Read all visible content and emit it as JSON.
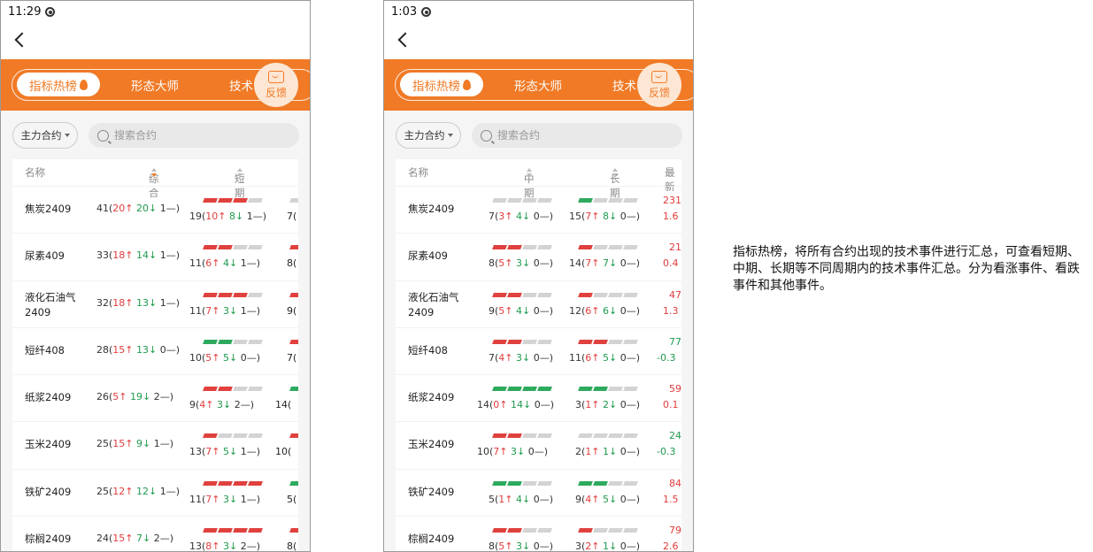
{
  "phones": [
    {
      "status_time": "11:29",
      "tabs": [
        "指标热榜",
        "形态大师",
        "技术"
      ],
      "feedback_label": "反馈",
      "contract_label": "主力合约",
      "search_placeholder": "搜索合约",
      "columns": [
        "名称",
        "综合",
        "短期"
      ],
      "rows": [
        {
          "name": "焦炭2409",
          "c1": {
            "total": "41",
            "up": "20",
            "down": "20",
            "flat": "1"
          },
          "c2": {
            "total": "19",
            "up": "10",
            "down": "8",
            "flat": "1"
          },
          "c2_segments": [
            "red",
            "red",
            "red",
            "grey"
          ],
          "c3_partial": "7(",
          "c3_segments": [
            "grey"
          ]
        },
        {
          "name": "尿素409",
          "c1": {
            "total": "33",
            "up": "18",
            "down": "14",
            "flat": "1"
          },
          "c2": {
            "total": "11",
            "up": "6",
            "down": "4",
            "flat": "1"
          },
          "c2_segments": [
            "red",
            "red",
            "grey",
            "grey"
          ],
          "c3_partial": "8(",
          "c3_segments": [
            "red"
          ]
        },
        {
          "name": "液化石油气\n2409",
          "c1": {
            "total": "32",
            "up": "18",
            "down": "13",
            "flat": "1"
          },
          "c2": {
            "total": "11",
            "up": "7",
            "down": "3",
            "flat": "1"
          },
          "c2_segments": [
            "red",
            "red",
            "red",
            "grey"
          ],
          "c3_partial": "9(",
          "c3_segments": [
            "red"
          ]
        },
        {
          "name": "短纤408",
          "c1": {
            "total": "28",
            "up": "15",
            "down": "13",
            "flat": "0"
          },
          "c2": {
            "total": "10",
            "up": "5",
            "down": "5",
            "flat": "0"
          },
          "c2_segments": [
            "green",
            "green",
            "grey",
            "grey"
          ],
          "c3_partial": "7(",
          "c3_segments": [
            "red"
          ]
        },
        {
          "name": "纸浆2409",
          "c1": {
            "total": "26",
            "up": "5",
            "down": "19",
            "flat": "2"
          },
          "c2": {
            "total": "9",
            "up": "4",
            "down": "3",
            "flat": "2"
          },
          "c2_segments": [
            "red",
            "red",
            "grey",
            "grey"
          ],
          "c3_partial": "14(",
          "c3_segments": [
            "green"
          ]
        },
        {
          "name": "玉米2409",
          "c1": {
            "total": "25",
            "up": "15",
            "down": "9",
            "flat": "1"
          },
          "c2": {
            "total": "13",
            "up": "7",
            "down": "5",
            "flat": "1"
          },
          "c2_segments": [
            "red",
            "grey",
            "grey",
            "grey"
          ],
          "c3_partial": "10(",
          "c3_segments": [
            "red"
          ]
        },
        {
          "name": "铁矿2409",
          "c1": {
            "total": "25",
            "up": "12",
            "down": "12",
            "flat": "1"
          },
          "c2": {
            "total": "11",
            "up": "7",
            "down": "3",
            "flat": "1"
          },
          "c2_segments": [
            "red",
            "red",
            "red",
            "red"
          ],
          "c3_partial": "5(",
          "c3_segments": [
            "green"
          ]
        },
        {
          "name": "棕榈2409",
          "c1": {
            "total": "24",
            "up": "15",
            "down": "7",
            "flat": "2"
          },
          "c2": {
            "total": "13",
            "up": "8",
            "down": "3",
            "flat": "2"
          },
          "c2_segments": [
            "red",
            "red",
            "red",
            "red"
          ],
          "c3_partial": "8(",
          "c3_segments": [
            "red"
          ]
        }
      ]
    },
    {
      "status_time": "1:03",
      "tabs": [
        "指标热榜",
        "形态大师",
        "技术"
      ],
      "feedback_label": "反馈",
      "contract_label": "主力合约",
      "search_placeholder": "搜索合约",
      "columns": [
        "名称",
        "中期",
        "长期",
        "最新"
      ],
      "rows": [
        {
          "name": "焦炭2409",
          "c1": {
            "total": "7",
            "up": "3",
            "down": "4",
            "flat": "0"
          },
          "c1_segments": [
            "grey",
            "grey",
            "grey",
            "grey"
          ],
          "c2": {
            "total": "15",
            "up": "7",
            "down": "8",
            "flat": "0"
          },
          "c2_segments": [
            "green",
            "grey",
            "grey",
            "grey"
          ],
          "price": "231",
          "pct": "1.6",
          "price_color": "red"
        },
        {
          "name": "尿素409",
          "c1": {
            "total": "8",
            "up": "5",
            "down": "3",
            "flat": "0"
          },
          "c1_segments": [
            "red",
            "red",
            "grey",
            "grey"
          ],
          "c2": {
            "total": "14",
            "up": "7",
            "down": "7",
            "flat": "0"
          },
          "c2_segments": [
            "red",
            "grey",
            "grey",
            "grey"
          ],
          "price": "21",
          "pct": "0.4",
          "price_color": "red"
        },
        {
          "name": "液化石油气\n2409",
          "c1": {
            "total": "9",
            "up": "5",
            "down": "4",
            "flat": "0"
          },
          "c1_segments": [
            "red",
            "red",
            "grey",
            "grey"
          ],
          "c2": {
            "total": "12",
            "up": "6",
            "down": "6",
            "flat": "0"
          },
          "c2_segments": [
            "red",
            "grey",
            "grey",
            "grey"
          ],
          "price": "47",
          "pct": "1.3",
          "price_color": "red"
        },
        {
          "name": "短纤408",
          "c1": {
            "total": "7",
            "up": "4",
            "down": "3",
            "flat": "0"
          },
          "c1_segments": [
            "red",
            "red",
            "grey",
            "grey"
          ],
          "c2": {
            "total": "11",
            "up": "6",
            "down": "5",
            "flat": "0"
          },
          "c2_segments": [
            "red",
            "red",
            "grey",
            "grey"
          ],
          "price": "77",
          "pct": "-0.3",
          "price_color": "green"
        },
        {
          "name": "纸浆2409",
          "c1": {
            "total": "14",
            "up": "0",
            "down": "14",
            "flat": "0"
          },
          "c1_segments": [
            "green",
            "green",
            "green",
            "green"
          ],
          "c2": {
            "total": "3",
            "up": "1",
            "down": "2",
            "flat": "0"
          },
          "c2_segments": [
            "green",
            "green",
            "grey",
            "grey"
          ],
          "price": "59",
          "pct": "0.1",
          "price_color": "red"
        },
        {
          "name": "玉米2409",
          "c1": {
            "total": "10",
            "up": "7",
            "down": "3",
            "flat": "0"
          },
          "c1_segments": [
            "red",
            "red",
            "grey",
            "grey"
          ],
          "c2": {
            "total": "2",
            "up": "1",
            "down": "1",
            "flat": "0"
          },
          "c2_segments": [
            "grey",
            "grey",
            "grey",
            "grey"
          ],
          "price": "24",
          "pct": "-0.3",
          "price_color": "green"
        },
        {
          "name": "铁矿2409",
          "c1": {
            "total": "5",
            "up": "1",
            "down": "4",
            "flat": "0"
          },
          "c1_segments": [
            "green",
            "green",
            "grey",
            "grey"
          ],
          "c2": {
            "total": "9",
            "up": "4",
            "down": "5",
            "flat": "0"
          },
          "c2_segments": [
            "green",
            "green",
            "grey",
            "grey"
          ],
          "price": "84",
          "pct": "1.5",
          "price_color": "red"
        },
        {
          "name": "棕榈2409",
          "c1": {
            "total": "8",
            "up": "5",
            "down": "3",
            "flat": "0"
          },
          "c1_segments": [
            "red",
            "red",
            "grey",
            "grey"
          ],
          "c2": {
            "total": "3",
            "up": "2",
            "down": "1",
            "flat": "0"
          },
          "c2_segments": [
            "red",
            "grey",
            "grey",
            "grey"
          ],
          "price": "79",
          "pct": "2.6",
          "price_color": "red"
        }
      ]
    }
  ],
  "description": "指标热榜，将所有合约出现的技术事件进行汇总，可查看短期、中期、长期等不同周期内的技术事件汇总。分为看涨事件、看跌事件和其他事件。",
  "symbols": {
    "up": "↑",
    "down": "↓",
    "flat": "—"
  },
  "colors": {
    "accent": "#f07a26",
    "up": "#e23b3b",
    "down": "#1f9a4e"
  }
}
